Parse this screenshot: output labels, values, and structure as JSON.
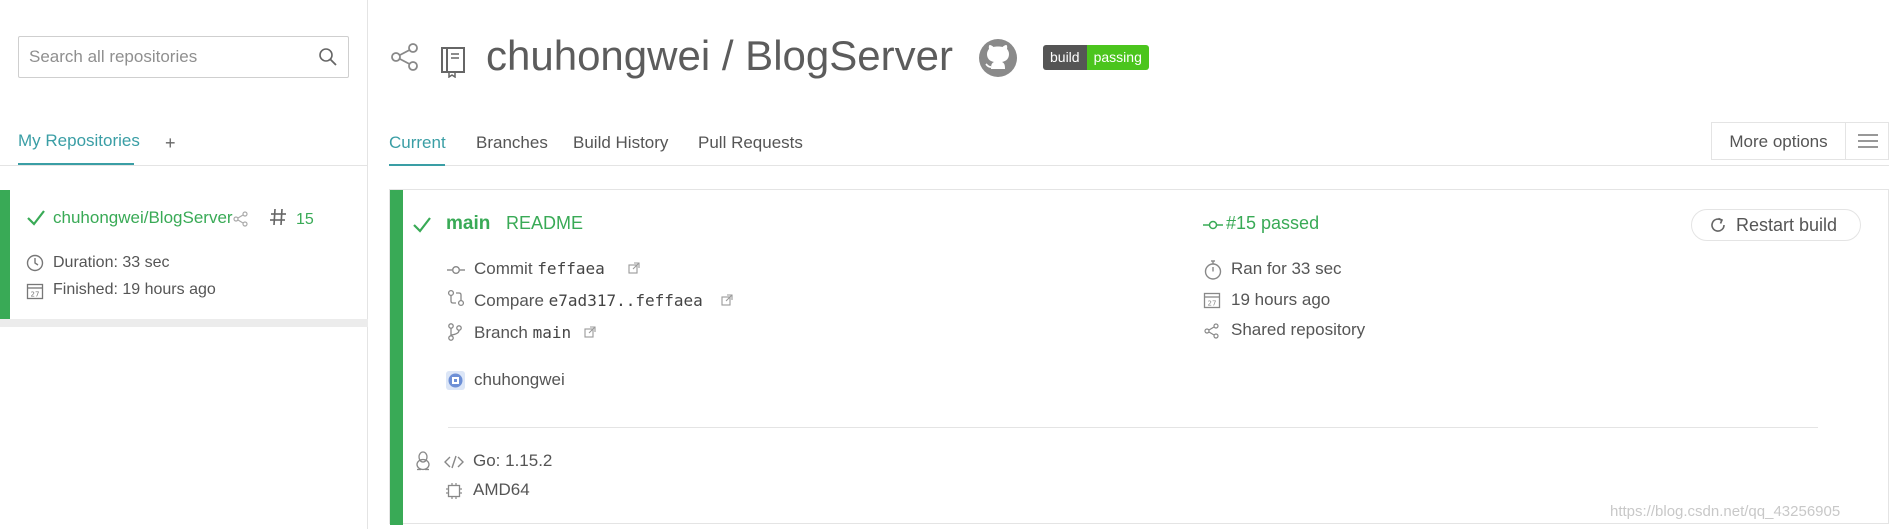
{
  "search": {
    "placeholder": "Search all repositories"
  },
  "sidebar": {
    "tab_label": "My Repositories",
    "add_label": "+",
    "repo": {
      "name": "chuhongwei/BlogServer",
      "build_number": "15",
      "duration": "Duration: 33 sec",
      "finished": "Finished: 19 hours ago",
      "status_color": "#39aa56"
    }
  },
  "header": {
    "title": "chuhongwei / BlogServer",
    "badge_left": "build",
    "badge_right": "passing"
  },
  "tabs": {
    "items": [
      {
        "label": "Current"
      },
      {
        "label": "Branches"
      },
      {
        "label": "Build History"
      },
      {
        "label": "Pull Requests"
      }
    ],
    "more_options": "More options"
  },
  "build": {
    "branch": "main",
    "commit_message": "README",
    "status": "#15 passed",
    "restart_label": "Restart build",
    "commit_label": "Commit",
    "commit_hash": "feffaea",
    "compare_label": "Compare",
    "compare_range": "e7ad317..feffaea",
    "branch_label": "Branch",
    "branch_value": "main",
    "author": "chuhongwei",
    "ran_for": "Ran for 33 sec",
    "finished_ago": "19 hours ago",
    "shared": "Shared repository",
    "go_version": "Go: 1.15.2",
    "arch": "AMD64"
  },
  "watermark": "https://blog.csdn.net/qq_43256905",
  "colors": {
    "accent": "#3a9ea5",
    "passed": "#39aa56",
    "badge_green": "#4bc51d"
  }
}
